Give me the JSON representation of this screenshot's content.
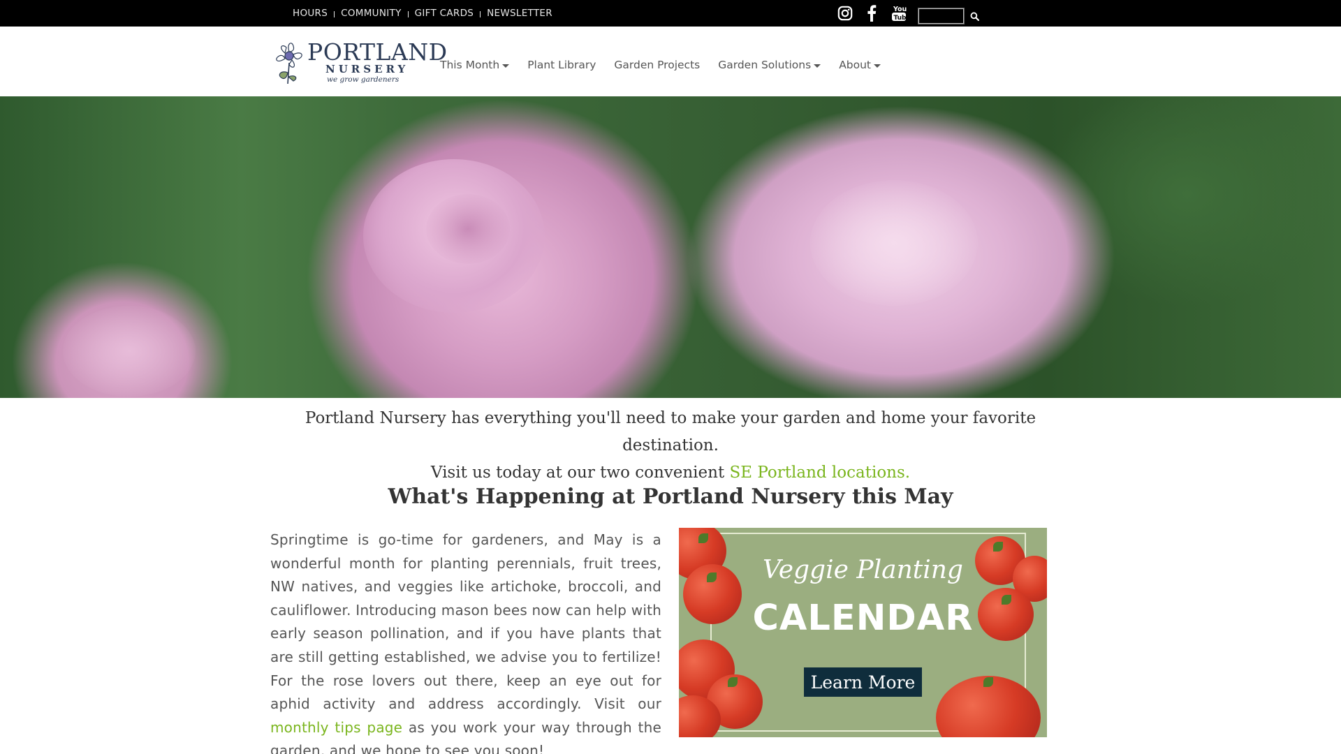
{
  "topbar": {
    "links": [
      "HOURS",
      "COMMUNITY",
      "GIFT CARDS",
      "NEWSLETTER"
    ],
    "social": [
      "instagram-icon",
      "facebook-icon",
      "youtube-icon"
    ],
    "search_value": ""
  },
  "logo": {
    "word1": "PORTLAND",
    "word2": "NURSERY",
    "tagline": "we grow gardeners"
  },
  "nav": {
    "items": [
      {
        "label": "This Month",
        "dropdown": true
      },
      {
        "label": "Plant Library",
        "dropdown": false
      },
      {
        "label": "Garden Projects",
        "dropdown": false
      },
      {
        "label": "Garden Solutions",
        "dropdown": true
      },
      {
        "label": "About",
        "dropdown": true
      }
    ]
  },
  "intro": {
    "line1": "Portland Nursery has everything you'll need to make your garden and home your favorite destination.",
    "line2_prefix": "Visit us today at our two convenient ",
    "line2_link": "SE Portland locations."
  },
  "section": {
    "heading": "What's Happening at Portland Nursery this May",
    "body_part1": "Springtime is go-time for gardeners, and May is a wonderful month for planting perennials, fruit trees, NW natives, and veggies like artichoke, broccoli, and cauliflower. Introducing mason bees now can help with early season pollination, and if you have plants that are still getting established, we advise you to fertilize! For the rose lovers out there, keep an eye out for aphid activity and address accordingly. Visit our ",
    "body_link": "monthly tips page",
    "body_part2": " as you work your way through the garden, and we hope to see you soon!"
  },
  "banner": {
    "title": "Veggie Planting",
    "subtitle": "CALENDAR",
    "button": "Learn More"
  },
  "colors": {
    "topbar": "#000000",
    "link_green": "#7ab51d",
    "logo_navy": "#2b3a55",
    "banner_bg": "#9bae80",
    "banner_button": "#0f2d3c"
  }
}
